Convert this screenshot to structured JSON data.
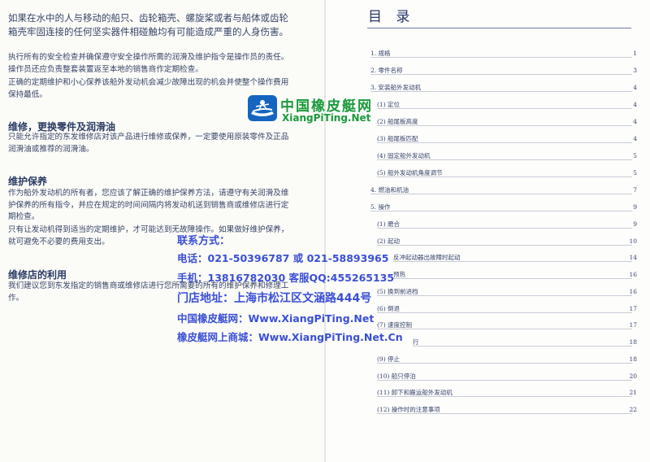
{
  "left": {
    "paragraphs": [
      "如果在水中的人与移动的船只、齿轮箱壳、螺旋桨或者与船体或齿轮箱壳牢固连接的任何坚实器件相碰触均有可能造成严重的人身伤害。",
      "执行所有的安全检查并确保遵守安全操作所需的润滑及维护指令是操作员的责任。操作员还应负责整套装置返至本地的销售商作定期检查。",
      "正确的定期维护和小心保养该船外发动机会减少故障出现的机会并使整个操作费用保持最低。"
    ],
    "sections": [
      {
        "heading": "维修，更换零件及润滑油",
        "paragraphs": [
          "只能允许指定的东发维修店对该产品进行维修或保养，一定要使用原装零件及正品润滑油或推荐的润滑油。"
        ]
      },
      {
        "heading": "维护保养",
        "paragraphs": [
          "作为船外发动机的所有者，您应该了解正确的维护保养方法，请遵守有关润滑及维护保养的所有指令，并应在规定的时间间隔内将发动机送到销售商或维修店进行定期检查。",
          "只有让发动机得到适当的定期维护，才可能达到无故障操作。如果做好维护保养，就可避免不必要的费用支出。"
        ]
      },
      {
        "heading": "维修店的利用",
        "paragraphs": [
          "我们建议您到东发指定的销售商或维修店进行您所需要的所有的维护保养和修理工作。"
        ]
      }
    ]
  },
  "toc": {
    "title": "目 录",
    "items": [
      {
        "label": "1. 规格",
        "page": "1"
      },
      {
        "label": "2. 零件名称",
        "page": "3"
      },
      {
        "label": "3. 安装船外发动机",
        "page": "4"
      },
      {
        "label": "(1) 定位",
        "page": "4"
      },
      {
        "label": "(2) 船尾板高度",
        "page": "4"
      },
      {
        "label": "(3) 船尾板匹配",
        "page": "4"
      },
      {
        "label": "(4) 固定船外发动机",
        "page": "5"
      },
      {
        "label": "(5) 船外发动机角度调节",
        "page": "5"
      },
      {
        "label": "4. 燃油和机油",
        "page": "7"
      },
      {
        "label": "5. 操作",
        "page": "9"
      },
      {
        "label": "(1) 磨合",
        "page": "9"
      },
      {
        "label": "(2) 起动",
        "page": "10"
      },
      {
        "label": "反冲起动器出故障时起动",
        "page": "14"
      },
      {
        "label": "预热",
        "page": "16"
      },
      {
        "label": "(5) 换到前进档",
        "page": "16"
      },
      {
        "label": "(6) 倒退",
        "page": "17"
      },
      {
        "label": "(7) 速度控制",
        "page": "17"
      },
      {
        "label": "行",
        "page": "18"
      },
      {
        "label": "(9) 停止",
        "page": "18"
      },
      {
        "label": "(10) 船只停泊",
        "page": "20"
      },
      {
        "label": "(11) 卸下和搬运船外发动机",
        "page": "21"
      },
      {
        "label": "(12) 操作时的注意事项",
        "page": "22"
      }
    ]
  },
  "watermark": {
    "logo_cn": "中国橡皮艇网",
    "logo_en": "XiangPiTing.Net",
    "contact_title": "联系方式：",
    "phone": "电话：021-50396787 或 021-58893965",
    "mobile": "手机：13816782030 客服QQ:455265135",
    "address": "门店地址：上海市松江区文涵路444号",
    "site": "中国橡皮艇网：Www.XiangPiTing.Net",
    "mall": "橡皮艇网上商城：Www.XiangPiTing.Net.Cn",
    "colors": {
      "text": "#3a4fd6",
      "logo": "#1a9a3a",
      "logo_icon_bg": "#1565c0"
    }
  }
}
